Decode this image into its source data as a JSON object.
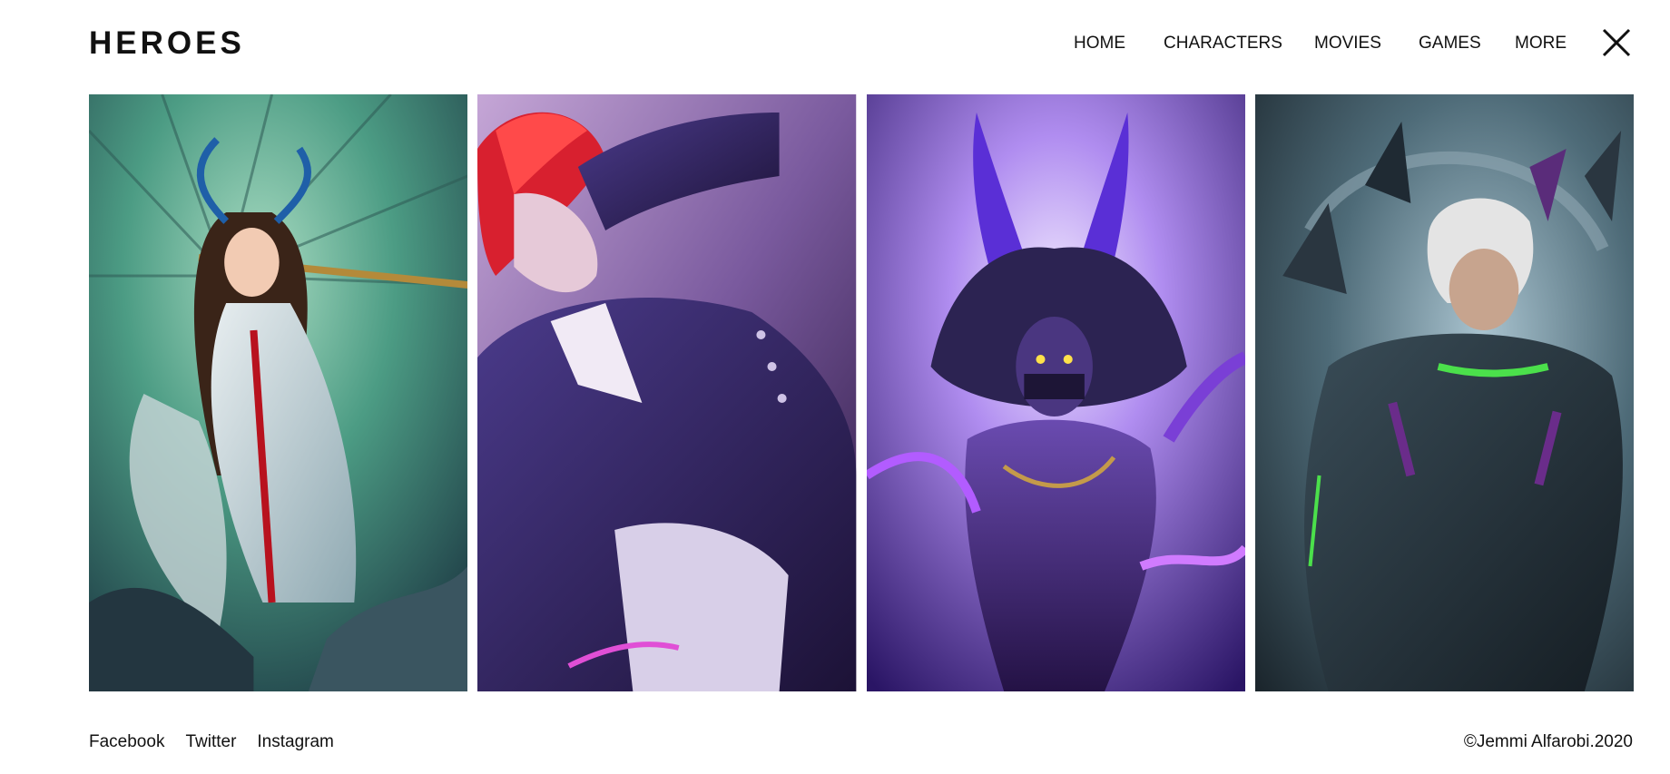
{
  "header": {
    "logo": "HEROES",
    "nav": [
      {
        "label": "HOME"
      },
      {
        "label": "CHARACTERS"
      },
      {
        "label": "MOVIES"
      },
      {
        "label": "GAMES"
      },
      {
        "label": "MORE"
      }
    ],
    "close_icon": "close-icon"
  },
  "gallery": {
    "cards": [
      {
        "icon": "hero-portrait-umbrella",
        "palette": [
          "#3f8f78",
          "#9dd3b8",
          "#2a4d57"
        ]
      },
      {
        "icon": "hero-portrait-redhair",
        "palette": [
          "#3a2a6b",
          "#b08cc9",
          "#d6263a"
        ]
      },
      {
        "icon": "hero-portrait-horned",
        "palette": [
          "#4a2aa8",
          "#c9b6f2",
          "#7a3fd6"
        ]
      },
      {
        "icon": "hero-portrait-armored",
        "palette": [
          "#1f2a33",
          "#6d8fa3",
          "#4be04b"
        ]
      }
    ]
  },
  "footer": {
    "social": [
      {
        "label": "Facebook"
      },
      {
        "label": "Twitter"
      },
      {
        "label": "Instagram"
      }
    ],
    "copyright": "©Jemmi Alfarobi.2020"
  }
}
